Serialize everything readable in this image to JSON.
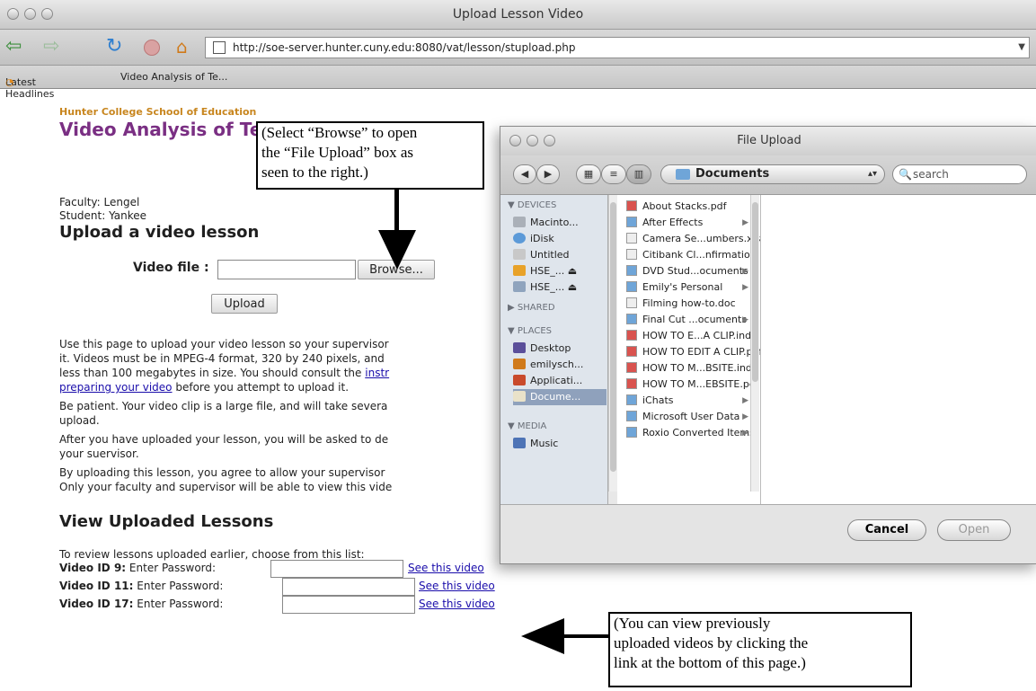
{
  "browser": {
    "window_title": "Upload Lesson Video",
    "url": "http://soe-server.hunter.cuny.edu:8080/vat/lesson/stupload.php",
    "bookmarks": [
      "Latest Headlines",
      "Video Analysis of Te..."
    ]
  },
  "page": {
    "school": "Hunter College School of Education",
    "site_title": "Video Analysis of Teac",
    "faculty": "Faculty: Lengel",
    "student": "Student: Yankee",
    "upload_heading": "Upload a video lesson",
    "video_file_label": "Video file :",
    "browse_label": "Browse...",
    "upload_label": "Upload",
    "para1_lines": [
      "Use this page to upload your video lesson so your supervisor",
      "it. Videos must be in MPEG-4 format, 320 by 240 pixels, and",
      "less than 100 megabytes in size. You should consult the "
    ],
    "para1_link_a": "instr",
    "para1_link_b": "preparing your video",
    "para1_tail": " before you attempt to upload it.",
    "para2_lines": [
      "Be patient. Your video clip is a large file, and will take severa",
      "upload."
    ],
    "para3_lines": [
      "After you have uploaded your lesson, you will be asked to de",
      "your suervisor."
    ],
    "para4_lines": [
      "By uploading this lesson, you agree to allow your supervisor",
      "Only your faculty and supervisor will be able to view this vide"
    ],
    "view_heading": "View Uploaded Lessons",
    "review_text": "To review lessons uploaded earlier, choose from this list:",
    "videos": [
      {
        "id": "Video ID 9:",
        "prompt": "Enter Password:",
        "link": "See this video"
      },
      {
        "id": "Video ID 11:",
        "prompt": "Enter Password:",
        "link": "See this video"
      },
      {
        "id": "Video ID 17:",
        "prompt": "Enter Password:",
        "link": "See this video"
      }
    ]
  },
  "callouts": {
    "browse_note": [
      "(Select “Browse” to open",
      "the “File Upload” box as",
      "seen to the right.)"
    ],
    "view_note": [
      "(You can view previously",
      "uploaded videos by clicking the",
      "link at the bottom of this page.)"
    ]
  },
  "dialog": {
    "title": "File Upload",
    "location": "Documents",
    "search_placeholder": "search",
    "sections": {
      "devices": "▼ DEVICES",
      "shared": "▶ SHARED",
      "places": "▼ PLACES",
      "media": "▼ MEDIA"
    },
    "devices": [
      "Macinto...",
      "iDisk",
      "Untitled",
      "HSE_... ⏏",
      "HSE_... ⏏"
    ],
    "places": [
      "Desktop",
      "emilysch...",
      "Applicati...",
      "Docume..."
    ],
    "media": [
      "Music"
    ],
    "files": [
      {
        "name": "About Stacks.pdf",
        "folder": false
      },
      {
        "name": "After Effects",
        "folder": true
      },
      {
        "name": "Camera Se...umbers.xls",
        "folder": false
      },
      {
        "name": "Citibank Cl...nfirmation",
        "folder": false
      },
      {
        "name": "DVD Stud...ocuments",
        "folder": true
      },
      {
        "name": "Emily's Personal",
        "folder": true
      },
      {
        "name": "Filming how-to.doc",
        "folder": false
      },
      {
        "name": "Final Cut ...ocuments",
        "folder": true
      },
      {
        "name": "HOW TO E...A CLIP.indd",
        "folder": false
      },
      {
        "name": "HOW TO EDIT A CLIP.pdf",
        "folder": false
      },
      {
        "name": "HOW TO M...BSITE.indd",
        "folder": false
      },
      {
        "name": "HOW TO M...EBSITE.pdf",
        "folder": false
      },
      {
        "name": "iChats",
        "folder": true
      },
      {
        "name": "Microsoft User Data",
        "folder": true
      },
      {
        "name": "Roxio Converted Items",
        "folder": true
      }
    ],
    "cancel_label": "Cancel",
    "open_label": "Open"
  }
}
